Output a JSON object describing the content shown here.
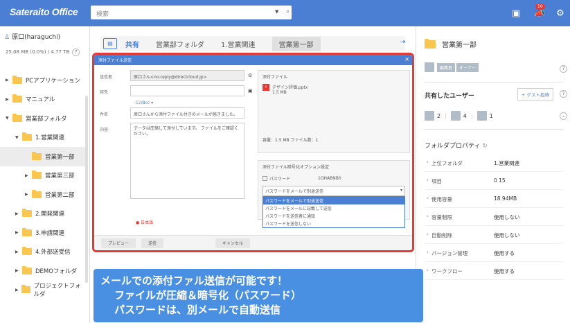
{
  "app": {
    "logo": "Sateraito Office"
  },
  "search": {
    "placeholder": "検索"
  },
  "topbar": {
    "notification_count": "10"
  },
  "sidebar": {
    "user": "原口(haraguchi)",
    "quota": "25.08 MB (0.0%) / 4.77 TB",
    "tree": [
      {
        "label": "PCアプリケーション",
        "level": 0
      },
      {
        "label": "マニュアル",
        "level": 0
      },
      {
        "label": "営業部フォルダ",
        "level": 0
      },
      {
        "label": "1.営業関連",
        "level": 1
      },
      {
        "label": "営業第一部",
        "level": 2
      },
      {
        "label": "営業第三部",
        "level": 2
      },
      {
        "label": "営業第二部",
        "level": 2
      },
      {
        "label": "2.開発関連",
        "level": 1
      },
      {
        "label": "3.申請関連",
        "level": 1
      },
      {
        "label": "4.外部送受信",
        "level": 1
      },
      {
        "label": "DEMOフォルダ",
        "level": 0
      },
      {
        "label": "プロジェクトフォルダ",
        "level": 0
      }
    ]
  },
  "breadcrumb": {
    "items": [
      "共有",
      "営業部フォルダ",
      "1.営業関連",
      "営業第一部"
    ]
  },
  "dialog": {
    "title": "添付ファイル送信",
    "from_label": "送信者",
    "from_value": "原口さん<no-reply@directcloud.jp>",
    "to_label": "宛先",
    "cc_link": "Cc/Bcc ▾",
    "subject_label": "件名",
    "subject_value": "原口さんから添付ファイル付きのメールが届きました。",
    "body_label": "内容",
    "body_value": "データは圧縮して添付しています。\nファイルをご確認ください。",
    "attach_note": "● 日本語",
    "attach_header": "添付ファイル",
    "file_name": "デザイン評価.pptx",
    "file_size": "1.5 MB",
    "total": "容量：1.5 MB  ファイル数：1",
    "enc_header": "添付ファイル暗号化オプション設定",
    "pw_label": "パスワード",
    "pw_value": "1OHABNB0",
    "select_value": "パスワードをメールで別途送信",
    "options": [
      "パスワードをメールで別途送信",
      "パスワードをメールに記載して送信",
      "パスワードを送信者に通知",
      "パスワードを送信しない"
    ],
    "btn_preview": "プレビュー",
    "btn_send": "送信",
    "btn_cancel": "キャンセル"
  },
  "right_panel": {
    "folder_title": "営業第一部",
    "roles": [
      "編集者",
      "オーナー"
    ],
    "shared_users_title": "共有したユーザー",
    "guest_button": "+ ゲスト招待",
    "counts": [
      "2",
      "4",
      "1"
    ],
    "props_title": "フォルダプロパティ",
    "props": [
      {
        "k": "上位フォルダ",
        "v": "1.営業関連"
      },
      {
        "k": "項目",
        "v": "0     15"
      },
      {
        "k": "使用容量",
        "v": "18.94MB"
      },
      {
        "k": "容量制限",
        "v": "使用しない"
      },
      {
        "k": "自動削除",
        "v": "使用しない"
      },
      {
        "k": "バージョン管理",
        "v": "使用する"
      },
      {
        "k": "ワークフロー",
        "v": "使用する"
      }
    ]
  },
  "banner": {
    "line1": "メールでの添付ファル送信が可能です！",
    "line2": "ファイルが圧縮＆暗号化（パスワード）",
    "line3": "パスワードは、別メールで自動送信"
  }
}
